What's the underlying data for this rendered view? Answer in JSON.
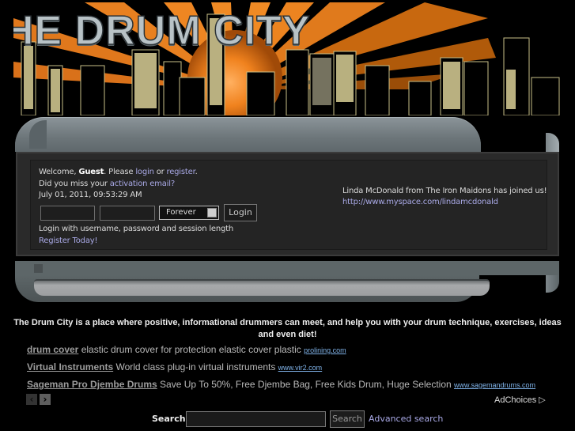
{
  "banner": {
    "title": "HE DRUM CITY",
    "colors": {
      "sunburst": "#f0821e",
      "building_windows": "#d9cf96",
      "title_fill": "#b8c2c6"
    }
  },
  "login_panel": {
    "welcome_prefix": "Welcome, ",
    "guest": "Guest",
    "please_text": ". Please ",
    "login_link": "login",
    "or_text": " or ",
    "register_link": "register",
    "period": ".",
    "missed_prefix": "Did you miss your ",
    "activation_link": "activation email?",
    "datetime": "July 01, 2011, 09:53:29 AM",
    "username_value": "",
    "password_value": "",
    "session_length": "Forever",
    "login_button": "Login",
    "hint": "Login with username, password and session length",
    "register_today": "Register Today!"
  },
  "news": {
    "headline": "Linda McDonald from The Iron Maidons has joined us!",
    "link": "http://www.myspace.com/lindamcdonald"
  },
  "description": "The Drum City is a place where positive, informational drummers can meet, and help you with your drum technique, exercises, ideas and even diet!",
  "ads": [
    {
      "title": "drum cover",
      "text": " elastic drum cover for protection elastic cover plastic ",
      "url": "prolining.com"
    },
    {
      "title": "Virtual Instruments",
      "text": " World class plug-in virtual instruments ",
      "url": "www.vir2.com"
    },
    {
      "title": "Sageman Pro Djembe Drums",
      "text": " Save Up To 50%, Free Djembe Bag, Free Kids Drum, Huge Selection ",
      "url": "www.sagemandrums.com"
    }
  ],
  "ad_nav": {
    "prev": "‹",
    "next": "›"
  },
  "adchoices": "AdChoices ▷",
  "search": {
    "label": "Search:",
    "value": "",
    "button": "Search",
    "advanced": "Advanced search"
  }
}
